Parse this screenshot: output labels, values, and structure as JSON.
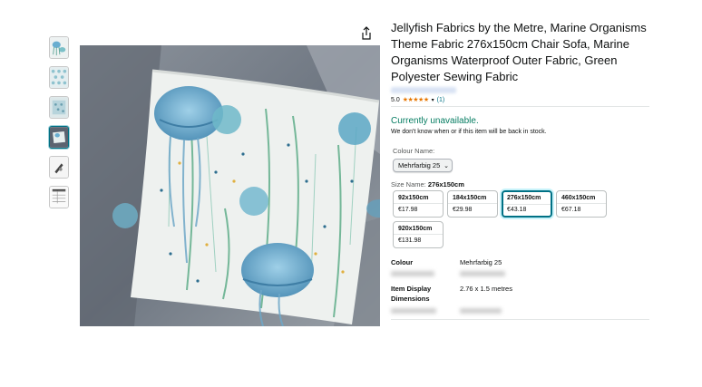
{
  "product": {
    "title": "Jellyfish Fabrics by the Metre, Marine Organisms Theme Fabric 276x150cm Chair Sofa, Marine Organisms Waterproof Outer Fabric, Green Polyester Sewing Fabric",
    "rating_value": "5.0",
    "rating_stars": "★★★★★",
    "rating_count": "(1)",
    "availability": "Currently unavailable.",
    "availability_note": "We don't know when or if this item will be back in stock."
  },
  "colour": {
    "label": "Colour Name:",
    "selected": "Mehrfarbig 25"
  },
  "size": {
    "label": "Size Name:",
    "selected": "276x150cm",
    "options": [
      {
        "name": "92x150cm",
        "price": "€17.98"
      },
      {
        "name": "184x150cm",
        "price": "€29.98"
      },
      {
        "name": "276x150cm",
        "price": "€43.18"
      },
      {
        "name": "460x150cm",
        "price": "€67.18"
      },
      {
        "name": "920x150cm",
        "price": "€131.98"
      }
    ]
  },
  "specs": [
    {
      "key": "Colour",
      "value": "Mehrfarbig 25"
    },
    {
      "key": "Item Display Dimensions",
      "value": "2.76 x 1.5 metres"
    }
  ],
  "icons": {
    "share": "share-icon",
    "chevron": "chevron-down-icon",
    "star": "star-icon"
  },
  "colors": {
    "accent": "#007185",
    "unavailable": "#067d62",
    "star": "#e77600"
  }
}
